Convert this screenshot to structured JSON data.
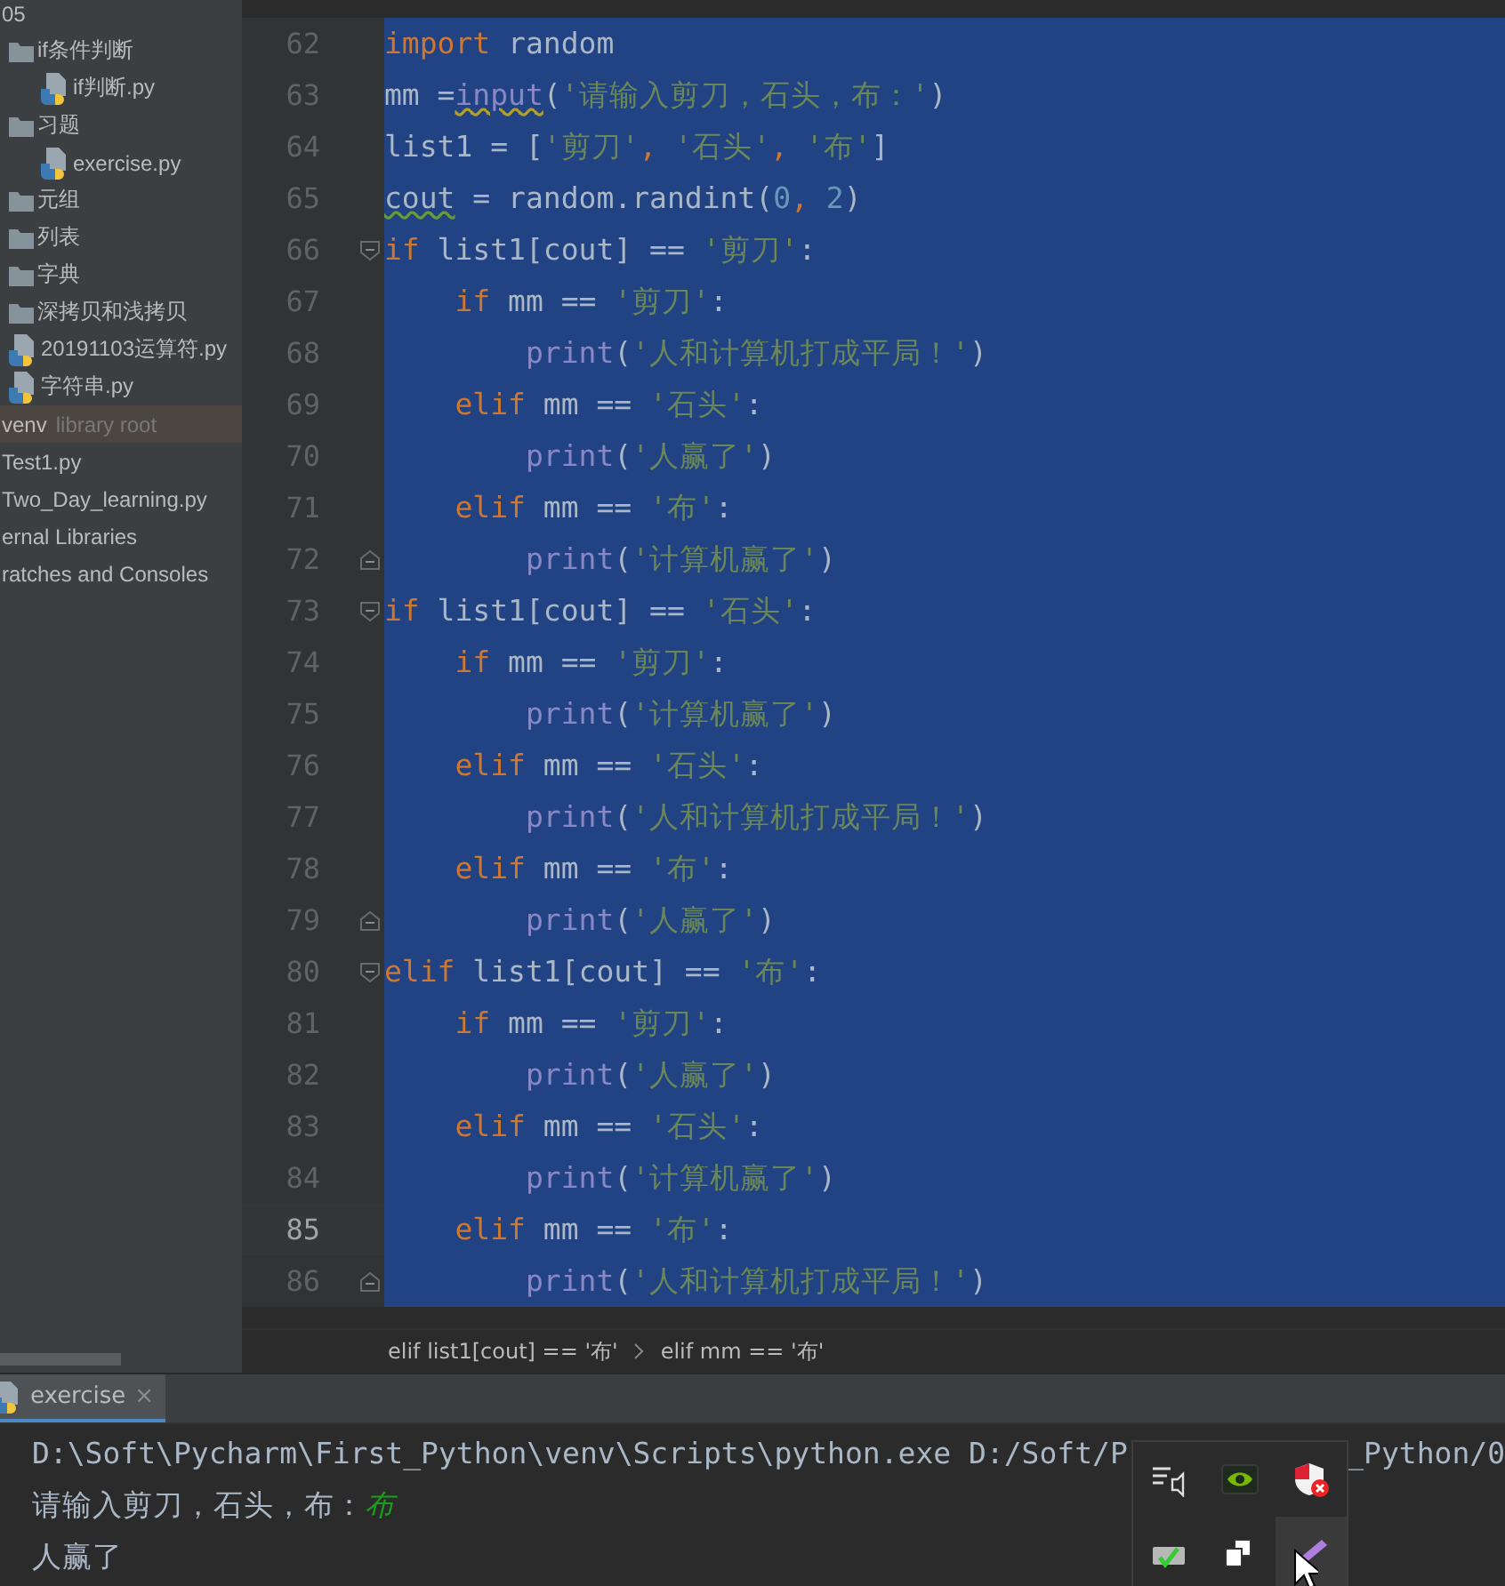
{
  "project_tree": {
    "items": [
      {
        "label": "05",
        "selected": false,
        "children": [
          {
            "label": "if条件判断",
            "kind": "folder",
            "selected": false,
            "children": [
              {
                "label": "if判断.py",
                "kind": "python_file",
                "selected": false
              }
            ]
          },
          {
            "label": "习题",
            "kind": "folder",
            "selected": false,
            "children": [
              {
                "label": "exercise.py",
                "kind": "python_file",
                "selected": false
              }
            ]
          },
          {
            "label": "元组",
            "kind": "folder",
            "selected": false
          },
          {
            "label": "列表",
            "kind": "folder",
            "selected": false
          },
          {
            "label": "字典",
            "kind": "folder",
            "selected": false
          },
          {
            "label": "深拷贝和浅拷贝",
            "kind": "folder",
            "selected": false
          },
          {
            "label": "20191103运算符.py",
            "kind": "python_file",
            "selected": false
          },
          {
            "label": "字符串.py",
            "kind": "python_file",
            "selected": false
          }
        ]
      },
      {
        "label": "venv",
        "note": "library root",
        "selected": true
      },
      {
        "label": "Test1.py",
        "selected": false
      },
      {
        "label": "Two_Day_learning.py",
        "selected": false
      },
      {
        "label": "ernal Libraries",
        "selected": false
      },
      {
        "label": "ratches and Consoles",
        "selected": false
      }
    ]
  },
  "editor": {
    "lines": [
      {
        "number": "62",
        "kind": "code",
        "selected": true,
        "current": false,
        "tokens": [
          {
            "kind": "keyword",
            "text": "import"
          },
          {
            "kind": "plain",
            "text": " random"
          }
        ]
      },
      {
        "number": "63",
        "kind": "code",
        "selected": true,
        "current": false,
        "tokens": [
          {
            "kind": "plain",
            "text": "mm ="
          },
          {
            "kind": "builtin",
            "text": "input",
            "underline": true
          },
          {
            "kind": "plain",
            "text": "("
          },
          {
            "kind": "string",
            "text": "'请输入剪刀，石头，布：'"
          },
          {
            "kind": "plain",
            "text": ")"
          }
        ]
      },
      {
        "number": "64",
        "kind": "code",
        "selected": true,
        "current": false,
        "tokens": [
          {
            "kind": "plain",
            "text": "list1 = ["
          },
          {
            "kind": "string",
            "text": "'剪刀'"
          },
          {
            "kind": "punct",
            "text": ","
          },
          {
            "kind": "string",
            "text": " '石头'"
          },
          {
            "kind": "punct",
            "text": ","
          },
          {
            "kind": "string",
            "text": " '布'"
          },
          {
            "kind": "plain",
            "text": "]"
          }
        ]
      },
      {
        "number": "65",
        "kind": "code",
        "selected": true,
        "current": false,
        "tokens": [
          {
            "kind": "plain",
            "text": "cout",
            "underline": true
          },
          {
            "kind": "plain",
            "text": " = random.randint("
          },
          {
            "kind": "number",
            "text": "0"
          },
          {
            "kind": "punct",
            "text": ","
          },
          {
            "kind": "number",
            "text": " 2"
          },
          {
            "kind": "plain",
            "text": ")"
          }
        ]
      },
      {
        "number": "66",
        "kind": "fold_start",
        "selected": true,
        "current": false,
        "tokens": [
          {
            "kind": "keyword",
            "text": "if"
          },
          {
            "kind": "plain",
            "text": " list1[cout] == "
          },
          {
            "kind": "string",
            "text": "'剪刀'"
          },
          {
            "kind": "plain",
            "text": ":"
          }
        ]
      },
      {
        "number": "67",
        "kind": "code",
        "selected": true,
        "current": false,
        "tokens": [
          {
            "kind": "keyword",
            "text": "    if"
          },
          {
            "kind": "plain",
            "text": " mm == "
          },
          {
            "kind": "string",
            "text": "'剪刀'"
          },
          {
            "kind": "plain",
            "text": ":"
          }
        ]
      },
      {
        "number": "68",
        "kind": "code",
        "selected": true,
        "current": false,
        "tokens": [
          {
            "kind": "builtin",
            "text": "        print"
          },
          {
            "kind": "plain",
            "text": "("
          },
          {
            "kind": "string",
            "text": "'人和计算机打成平局！'"
          },
          {
            "kind": "plain",
            "text": ")"
          }
        ]
      },
      {
        "number": "69",
        "kind": "code",
        "selected": true,
        "current": false,
        "tokens": [
          {
            "kind": "keyword",
            "text": "    elif"
          },
          {
            "kind": "plain",
            "text": " mm == "
          },
          {
            "kind": "string",
            "text": "'石头'"
          },
          {
            "kind": "plain",
            "text": ":"
          }
        ]
      },
      {
        "number": "70",
        "kind": "code",
        "selected": true,
        "current": false,
        "tokens": [
          {
            "kind": "builtin",
            "text": "        print"
          },
          {
            "kind": "plain",
            "text": "("
          },
          {
            "kind": "string",
            "text": "'人赢了'"
          },
          {
            "kind": "plain",
            "text": ")"
          }
        ]
      },
      {
        "number": "71",
        "kind": "code",
        "selected": true,
        "current": false,
        "tokens": [
          {
            "kind": "keyword",
            "text": "    elif"
          },
          {
            "kind": "plain",
            "text": " mm == "
          },
          {
            "kind": "string",
            "text": "'布'"
          },
          {
            "kind": "plain",
            "text": ":"
          }
        ]
      },
      {
        "number": "72",
        "kind": "fold_end",
        "selected": true,
        "current": false,
        "tokens": [
          {
            "kind": "builtin",
            "text": "        print"
          },
          {
            "kind": "plain",
            "text": "("
          },
          {
            "kind": "string",
            "text": "'计算机赢了'"
          },
          {
            "kind": "plain",
            "text": ")"
          }
        ]
      },
      {
        "number": "73",
        "kind": "fold_start",
        "selected": true,
        "current": false,
        "tokens": [
          {
            "kind": "keyword",
            "text": "if"
          },
          {
            "kind": "plain",
            "text": " list1[cout] == "
          },
          {
            "kind": "string",
            "text": "'石头'"
          },
          {
            "kind": "plain",
            "text": ":"
          }
        ]
      },
      {
        "number": "74",
        "kind": "code",
        "selected": true,
        "current": false,
        "tokens": [
          {
            "kind": "keyword",
            "text": "    if"
          },
          {
            "kind": "plain",
            "text": " mm == "
          },
          {
            "kind": "string",
            "text": "'剪刀'"
          },
          {
            "kind": "plain",
            "text": ":"
          }
        ]
      },
      {
        "number": "75",
        "kind": "code",
        "selected": true,
        "current": false,
        "tokens": [
          {
            "kind": "builtin",
            "text": "        print"
          },
          {
            "kind": "plain",
            "text": "("
          },
          {
            "kind": "string",
            "text": "'计算机赢了'"
          },
          {
            "kind": "plain",
            "text": ")"
          }
        ]
      },
      {
        "number": "76",
        "kind": "code",
        "selected": true,
        "current": false,
        "tokens": [
          {
            "kind": "keyword",
            "text": "    elif"
          },
          {
            "kind": "plain",
            "text": " mm == "
          },
          {
            "kind": "string",
            "text": "'石头'"
          },
          {
            "kind": "plain",
            "text": ":"
          }
        ]
      },
      {
        "number": "77",
        "kind": "code",
        "selected": true,
        "current": false,
        "tokens": [
          {
            "kind": "builtin",
            "text": "        print"
          },
          {
            "kind": "plain",
            "text": "("
          },
          {
            "kind": "string",
            "text": "'人和计算机打成平局！'"
          },
          {
            "kind": "plain",
            "text": ")"
          }
        ]
      },
      {
        "number": "78",
        "kind": "code",
        "selected": true,
        "current": false,
        "tokens": [
          {
            "kind": "keyword",
            "text": "    elif"
          },
          {
            "kind": "plain",
            "text": " mm == "
          },
          {
            "kind": "string",
            "text": "'布'"
          },
          {
            "kind": "plain",
            "text": ":"
          }
        ]
      },
      {
        "number": "79",
        "kind": "fold_end",
        "selected": true,
        "current": false,
        "tokens": [
          {
            "kind": "builtin",
            "text": "        print"
          },
          {
            "kind": "plain",
            "text": "("
          },
          {
            "kind": "string",
            "text": "'人赢了'"
          },
          {
            "kind": "plain",
            "text": ")"
          }
        ]
      },
      {
        "number": "80",
        "kind": "fold_start",
        "selected": true,
        "current": false,
        "tokens": [
          {
            "kind": "keyword",
            "text": "elif"
          },
          {
            "kind": "plain",
            "text": " list1[cout] == "
          },
          {
            "kind": "string",
            "text": "'布'"
          },
          {
            "kind": "plain",
            "text": ":"
          }
        ]
      },
      {
        "number": "81",
        "kind": "code",
        "selected": true,
        "current": false,
        "tokens": [
          {
            "kind": "keyword",
            "text": "    if"
          },
          {
            "kind": "plain",
            "text": " mm == "
          },
          {
            "kind": "string",
            "text": "'剪刀'"
          },
          {
            "kind": "plain",
            "text": ":"
          }
        ]
      },
      {
        "number": "82",
        "kind": "code",
        "selected": true,
        "current": false,
        "tokens": [
          {
            "kind": "builtin",
            "text": "        print"
          },
          {
            "kind": "plain",
            "text": "("
          },
          {
            "kind": "string",
            "text": "'人赢了'"
          },
          {
            "kind": "plain",
            "text": ")"
          }
        ]
      },
      {
        "number": "83",
        "kind": "code",
        "selected": true,
        "current": false,
        "tokens": [
          {
            "kind": "keyword",
            "text": "    elif"
          },
          {
            "kind": "plain",
            "text": " mm == "
          },
          {
            "kind": "string",
            "text": "'石头'"
          },
          {
            "kind": "plain",
            "text": ":"
          }
        ]
      },
      {
        "number": "84",
        "kind": "code",
        "selected": true,
        "current": false,
        "tokens": [
          {
            "kind": "builtin",
            "text": "        print"
          },
          {
            "kind": "plain",
            "text": "("
          },
          {
            "kind": "string",
            "text": "'计算机赢了'"
          },
          {
            "kind": "plain",
            "text": ")"
          }
        ]
      },
      {
        "number": "85",
        "kind": "code",
        "selected": true,
        "current": true,
        "tokens": [
          {
            "kind": "keyword",
            "text": "    elif"
          },
          {
            "kind": "plain",
            "text": " mm == "
          },
          {
            "kind": "string",
            "text": "'布'"
          },
          {
            "kind": "plain",
            "text": ":"
          }
        ]
      },
      {
        "number": "86",
        "kind": "fold_end",
        "selected": true,
        "current": false,
        "tokens": [
          {
            "kind": "builtin",
            "text": "        print"
          },
          {
            "kind": "plain",
            "text": "("
          },
          {
            "kind": "string",
            "text": "'人和计算机打成平局！'"
          },
          {
            "kind": "plain",
            "text": ")"
          }
        ]
      }
    ]
  },
  "breadcrumbs": [
    "elif list1[cout] == '布'",
    "elif mm == '布'"
  ],
  "run_panel": {
    "tabs": [
      {
        "label": "exercise",
        "close": "×",
        "selected": true
      }
    ],
    "output": {
      "command": [
        "D:\\Soft\\Pycharm\\First_Python\\venv\\Scripts\\python.exe D:/Soft/P",
        "_Python/0"
      ],
      "prompt": "请输入剪刀，石头，布：",
      "user_input": "布",
      "result": "人赢了"
    }
  },
  "tray_popup": {
    "items": [
      {
        "kind": "speaker",
        "hovered": false
      },
      {
        "kind": "graphics",
        "hovered": false
      },
      {
        "kind": "shield",
        "hovered": false
      },
      {
        "kind": "drive",
        "hovered": false
      },
      {
        "kind": "devices",
        "hovered": false
      },
      {
        "kind": "pen",
        "hovered": true
      }
    ]
  }
}
